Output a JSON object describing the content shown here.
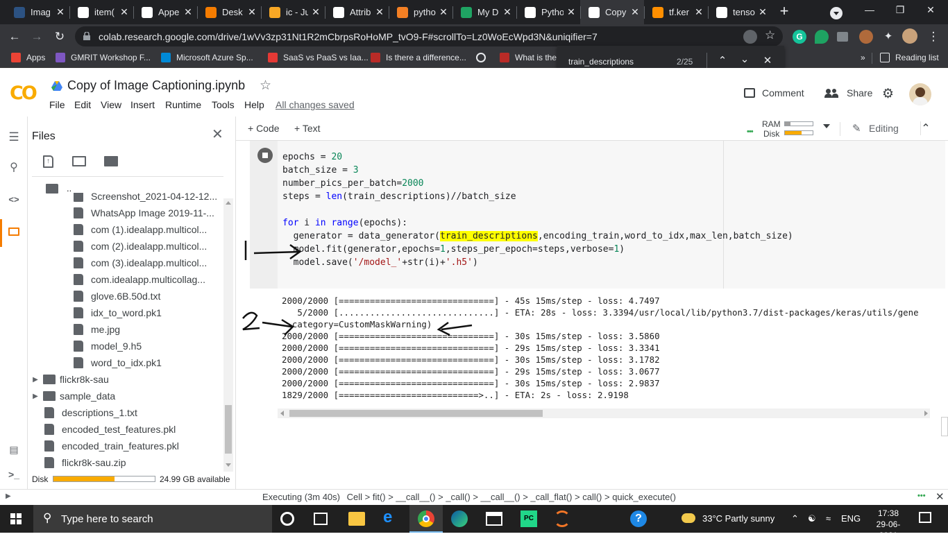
{
  "browser": {
    "tabs": [
      {
        "label": "Imag",
        "icon": "k-icon",
        "color": "#2c5282"
      },
      {
        "label": "item(",
        "icon": "google-icon",
        "color": "#ffffff"
      },
      {
        "label": "Appe",
        "icon": "page-icon",
        "color": "#ffffff"
      },
      {
        "label": "Desk",
        "icon": "swirl-icon",
        "color": "#f57c00"
      },
      {
        "label": "ic - Ju",
        "icon": "jupyter-icon",
        "color": "#f9a825"
      },
      {
        "label": "Attrib",
        "icon": "google-icon",
        "color": "#ffffff"
      },
      {
        "label": "pytho",
        "icon": "stackoverflow-icon",
        "color": "#f48024"
      },
      {
        "label": "My D",
        "icon": "drive-icon",
        "color": "#1fa463"
      },
      {
        "label": "Pytho",
        "icon": "python-icon",
        "color": "#ffffff"
      },
      {
        "label": "Copy",
        "icon": "colab-icon",
        "color": "#ffffff",
        "active": true
      },
      {
        "label": "tf.ker",
        "icon": "tensorflow-icon",
        "color": "#ff8f00"
      },
      {
        "label": "tenso",
        "icon": "github-icon",
        "color": "#ffffff"
      }
    ],
    "url": "colab.research.google.com/drive/1wVv3zp31Nt1R2mCbrpsRoHoMP_tvO9-F#scrollTo=Lz0WoEcWpd3N&uniqifier=7",
    "bookmarks": [
      {
        "label": "Apps",
        "icon": "apps-grid-icon"
      },
      {
        "label": "GMRIT Workshop F...",
        "icon": "forms-icon"
      },
      {
        "label": "Microsoft Azure Sp...",
        "icon": "azure-icon"
      },
      {
        "label": "SaaS vs PaaS vs Iaa...",
        "icon": "bookmark-red-icon"
      },
      {
        "label": "Is there a difference...",
        "icon": "quora-icon"
      },
      {
        "label": "What is the",
        "icon": "quora-icon"
      }
    ],
    "reading_list": "Reading list",
    "more_bookmarks": "»"
  },
  "findbar": {
    "query": "train_descriptions",
    "count": "2/25"
  },
  "colab": {
    "logo": "CO",
    "title": "Copy of Image Captioning.ipynb",
    "menu": [
      "File",
      "Edit",
      "View",
      "Insert",
      "Runtime",
      "Tools",
      "Help"
    ],
    "saved_status": "All changes saved",
    "comment_label": "Comment",
    "share_label": "Share",
    "add_code": "+ Code",
    "add_text": "+ Text",
    "ram_label": "RAM",
    "disk_label": "Disk",
    "ram_level": 0.2,
    "disk_level": 0.6,
    "editing_label": "Editing"
  },
  "files_panel": {
    "title": "Files",
    "parent": "..",
    "items": [
      {
        "name": "Screenshot_2021-04-12-12...",
        "type": "file",
        "depth": 1
      },
      {
        "name": "WhatsApp Image 2019-11-...",
        "type": "file",
        "depth": 1
      },
      {
        "name": "com (1).idealapp.multicol...",
        "type": "file",
        "depth": 1
      },
      {
        "name": "com (2).idealapp.multicol...",
        "type": "file",
        "depth": 1
      },
      {
        "name": "com (3).idealapp.multicol...",
        "type": "file",
        "depth": 1
      },
      {
        "name": "com.idealapp.multicollag...",
        "type": "file",
        "depth": 1
      },
      {
        "name": "glove.6B.50d.txt",
        "type": "file",
        "depth": 1
      },
      {
        "name": "idx_to_word.pk1",
        "type": "file",
        "depth": 1
      },
      {
        "name": "me.jpg",
        "type": "file",
        "depth": 1
      },
      {
        "name": "model_9.h5",
        "type": "file",
        "depth": 1
      },
      {
        "name": "word_to_idx.pk1",
        "type": "file",
        "depth": 1
      },
      {
        "name": "flickr8k-sau",
        "type": "folder",
        "depth": 0
      },
      {
        "name": "sample_data",
        "type": "folder",
        "depth": 0
      },
      {
        "name": "descriptions_1.txt",
        "type": "file",
        "depth": 0
      },
      {
        "name": "encoded_test_features.pkl",
        "type": "file",
        "depth": 0
      },
      {
        "name": "encoded_train_features.pkl",
        "type": "file",
        "depth": 0
      },
      {
        "name": "flickr8k-sau.zip",
        "type": "file",
        "depth": 0
      }
    ],
    "disk_label": "Disk",
    "disk_available": "24.99 GB available",
    "disk_used_fraction": 0.6
  },
  "cell": {
    "code_lines": [
      [
        [
          "epochs = ",
          ""
        ],
        [
          "20",
          "nm"
        ]
      ],
      [
        [
          "batch_size = ",
          ""
        ],
        [
          "3",
          "nm"
        ]
      ],
      [
        [
          "number_pics_per_batch=",
          ""
        ],
        [
          "2000",
          "nm"
        ]
      ],
      [
        [
          "steps = ",
          ""
        ],
        [
          "len",
          "kw"
        ],
        [
          "(train_descriptions)//batch_size",
          ""
        ]
      ],
      [
        [
          "",
          ""
        ]
      ],
      [
        [
          "for",
          "kw"
        ],
        [
          " i ",
          ""
        ],
        [
          "in",
          "kw"
        ],
        [
          " ",
          ""
        ],
        [
          "range",
          "kw"
        ],
        [
          "(epochs):",
          ""
        ]
      ],
      [
        [
          "  generator = data_generator(",
          ""
        ],
        [
          "train_descriptions",
          "hl"
        ],
        [
          ",encoding_train,word_to_idx,max_len,batch_size)",
          ""
        ]
      ],
      [
        [
          "  model.fit(generator,epochs=",
          ""
        ],
        [
          "1",
          "nm"
        ],
        [
          ",steps_per_epoch=steps,verbose=",
          ""
        ],
        [
          "1",
          "nm"
        ],
        [
          ")",
          ""
        ]
      ],
      [
        [
          "  model.save(",
          ""
        ],
        [
          "'/model_'",
          "st"
        ],
        [
          "+str(i)+",
          ""
        ],
        [
          "'.h5'",
          "st"
        ],
        [
          ")",
          ""
        ]
      ]
    ],
    "output_lines": [
      "2000/2000 [==============================] - 45s 15ms/step - loss: 4.7497",
      "   5/2000 [..............................] - ETA: 28s - loss: 3.3394/usr/local/lib/python3.7/dist-packages/keras/utils/gene",
      "  category=CustomMaskWarning)",
      "2000/2000 [==============================] - 30s 15ms/step - loss: 3.5860",
      "2000/2000 [==============================] - 29s 15ms/step - loss: 3.3341",
      "2000/2000 [==============================] - 30s 15ms/step - loss: 3.1782",
      "2000/2000 [==============================] - 29s 15ms/step - loss: 3.0677",
      "2000/2000 [==============================] - 30s 15ms/step - loss: 2.9837",
      "1829/2000 [===========================>..] - ETA: 2s - loss: 2.9198"
    ]
  },
  "status": {
    "executing": "Executing (3m 40s)",
    "trace": "Cell > fit() > __call__() > _call() > __call__() > _call_flat() > call() > quick_execute()"
  },
  "taskbar": {
    "search_placeholder": "Type here to search",
    "weather": "33°C  Partly sunny",
    "lang": "ENG",
    "time": "17:38",
    "date": "29-06-2021"
  }
}
